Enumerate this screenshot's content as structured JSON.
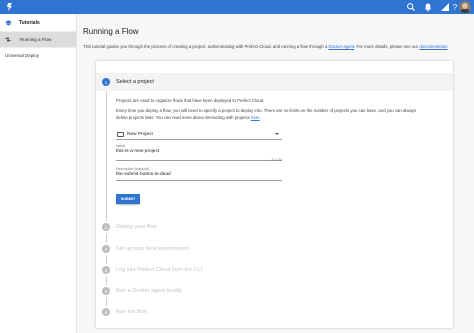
{
  "topbar": {
    "color": "#2f74d0",
    "logo_icon": "prefect-logo-icon",
    "icons": [
      "search-icon",
      "notifications-icon",
      "signal-icon",
      "help-icon",
      "avatar"
    ]
  },
  "sidebar": {
    "heading": "Tutorials",
    "heading_icon": "school-icon",
    "items": [
      {
        "label": "Running a Flow",
        "icon": "flow-icon",
        "active": true
      },
      {
        "label": "Universal Deploy",
        "active": false
      }
    ]
  },
  "main": {
    "title": "Running a Flow",
    "intro": "This tutorial guides you through the process of creating a project, authenticating with Prefect Cloud, and running a flow through a ",
    "intro_link1": "Docker agent",
    "intro_mid": ". For more details, please see our ",
    "intro_link2": "documentation",
    "intro_end": "."
  },
  "stepper": {
    "steps": [
      {
        "num": "1",
        "label": "Select a project",
        "active": true
      },
      {
        "num": "2",
        "label": "Deploy your flow"
      },
      {
        "num": "3",
        "label": "Set up your local environment"
      },
      {
        "num": "4",
        "label": "Log into Prefect Cloud from the CLI"
      },
      {
        "num": "5",
        "label": "Run a Docker agent locally"
      },
      {
        "num": "6",
        "label": "Run the flow"
      }
    ],
    "step1": {
      "para1": "Projects are used to organize flows that have been deployed to Prefect Cloud.",
      "para2_line1": "Every time you deploy a flow, you will need to specify a project to deploy into. There are no limits on the number of projects you can have, and you can always",
      "para2_line2": "delete projects later. You can read more about interacting with projects ",
      "para2_link": "here",
      "para2_end": ".",
      "select_value": "New Project",
      "name_label": "Name",
      "name_value": "this-is-a-new-project",
      "name_counter": "21 / 30",
      "desc_label": "Description (optional)",
      "desc_value": "the-submit-button-is-dead",
      "submit_label": "SUBMIT"
    }
  }
}
